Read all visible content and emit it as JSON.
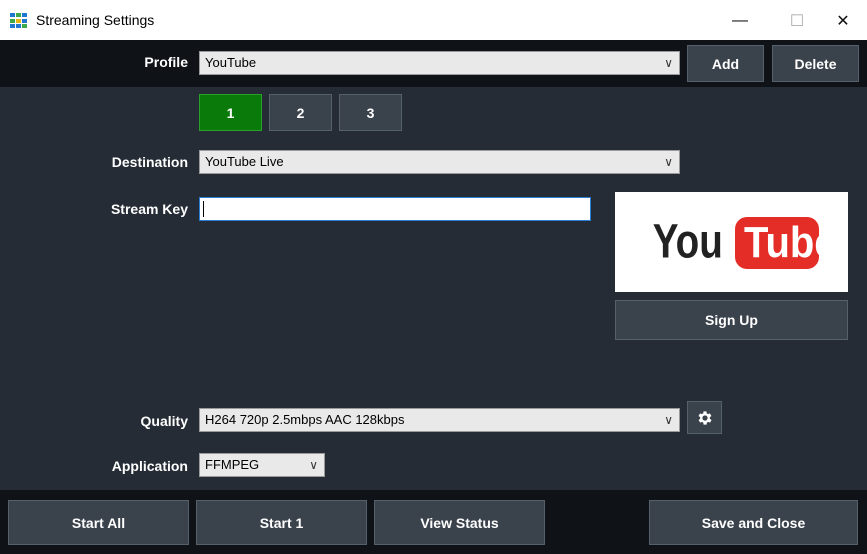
{
  "window": {
    "title": "Streaming Settings",
    "minimize": "—",
    "maximize": "☐",
    "close": "✕"
  },
  "profile": {
    "label": "Profile",
    "value": "YouTube",
    "add_label": "Add",
    "delete_label": "Delete"
  },
  "tabs": [
    {
      "label": "1",
      "active": true
    },
    {
      "label": "2",
      "active": false
    },
    {
      "label": "3",
      "active": false
    }
  ],
  "destination": {
    "label": "Destination",
    "value": "YouTube Live"
  },
  "stream_key": {
    "label": "Stream Key",
    "value": ""
  },
  "logo": {
    "you": "You",
    "tube": "Tube",
    "colors": {
      "red": "#e52d27",
      "text": "#222222"
    }
  },
  "sign_up_label": "Sign Up",
  "quality": {
    "label": "Quality",
    "value": "H264 720p 2.5mbps AAC 128kbps"
  },
  "application": {
    "label": "Application",
    "value": "FFMPEG"
  },
  "footer": {
    "start_all": "Start All",
    "start_1": "Start 1",
    "view_status": "View Status",
    "save_close": "Save and Close"
  },
  "icons": {
    "chevron": "∨"
  }
}
